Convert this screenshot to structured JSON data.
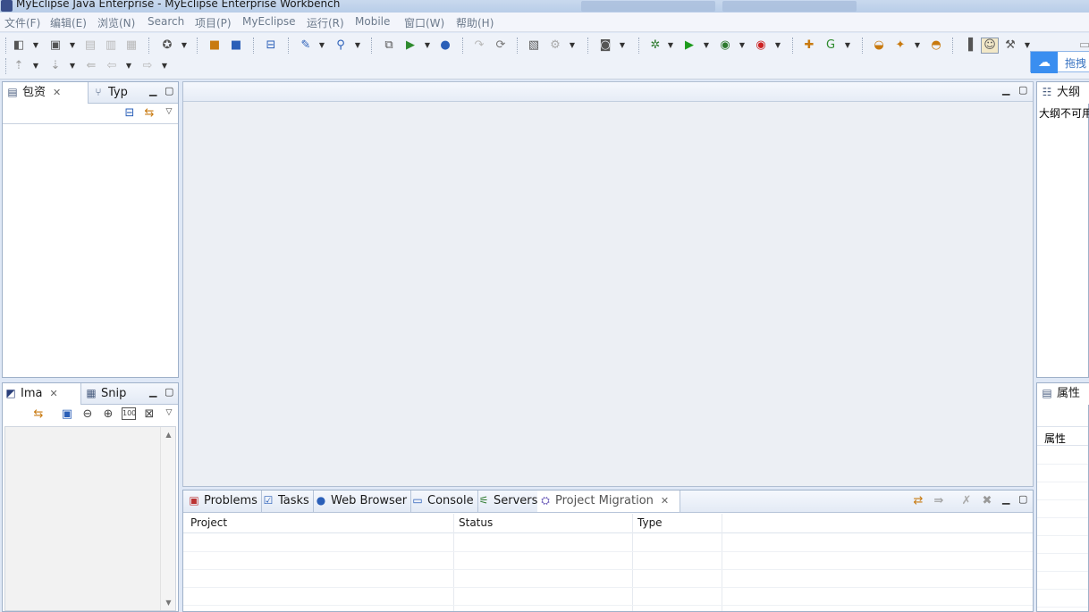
{
  "window": {
    "title": "MyEclipse Java Enterprise  -  MyEclipse Enterprise Workbench"
  },
  "menu": [
    "文件(F)",
    "编辑(E)",
    "浏览(N)",
    "Search",
    "项目(P)",
    "MyEclipse",
    "运行(R)",
    "Mobile",
    "窗口(W)",
    "帮助(H)"
  ],
  "cloud_button": {
    "label": "拖拽",
    "icon": "cloud-icon"
  },
  "left_top_panel": {
    "tabs": [
      {
        "label": "包资",
        "icon": "package-explorer-icon"
      },
      {
        "label": "Typ",
        "icon": "type-hierarchy-icon"
      }
    ]
  },
  "left_bottom_panel": {
    "tabs": [
      {
        "label": "Ima",
        "icon": "image-preview-icon"
      },
      {
        "label": "Snip",
        "icon": "snippets-icon"
      }
    ]
  },
  "outline_panel": {
    "tab": "大纲",
    "message": "大纲不可用"
  },
  "properties_panel": {
    "tab": "属性",
    "column": "属性"
  },
  "bottom_panel": {
    "tabs": [
      {
        "label": "Problems",
        "icon": "problems-icon"
      },
      {
        "label": "Tasks",
        "icon": "tasks-icon"
      },
      {
        "label": "Web Browser",
        "icon": "globe-icon"
      },
      {
        "label": "Console",
        "icon": "console-icon"
      },
      {
        "label": "Servers",
        "icon": "servers-icon"
      },
      {
        "label": "Project Migration",
        "icon": "migration-icon"
      }
    ],
    "table_headers": [
      "Project",
      "Status",
      "Type"
    ]
  },
  "colors": {
    "chrome_bg": "#dfe8f6",
    "tab_border": "#9fb1c9",
    "menu_text": "#6c7a8c",
    "cloud_accent": "#3a8ef0"
  }
}
